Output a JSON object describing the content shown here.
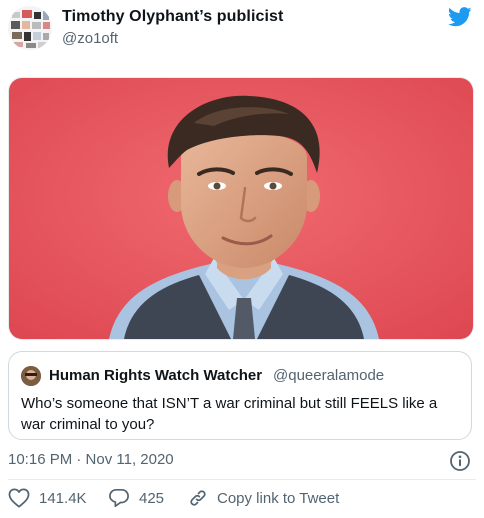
{
  "tweet": {
    "author_name": "Timothy Olyphant’s publicist",
    "author_handle": "@zo1oft",
    "timestamp": "10:16 PM · Nov 11, 2020"
  },
  "quoted": {
    "author_name": "Human Rights Watch Watcher",
    "author_handle": "@queeralamode",
    "text": "Who’s someone that ISN’T a war criminal but still FEELS like a war criminal to you?"
  },
  "actions": {
    "likes": "141.4K",
    "replies": "425",
    "copy_link": "Copy link to Tweet"
  },
  "colors": {
    "twitter_blue": "#1d9bf0",
    "photo_background": "#e8525a",
    "secondary_text": "#536471"
  },
  "icons": [
    "twitter-bird-icon",
    "info-icon",
    "heart-icon",
    "reply-icon",
    "link-icon"
  ]
}
